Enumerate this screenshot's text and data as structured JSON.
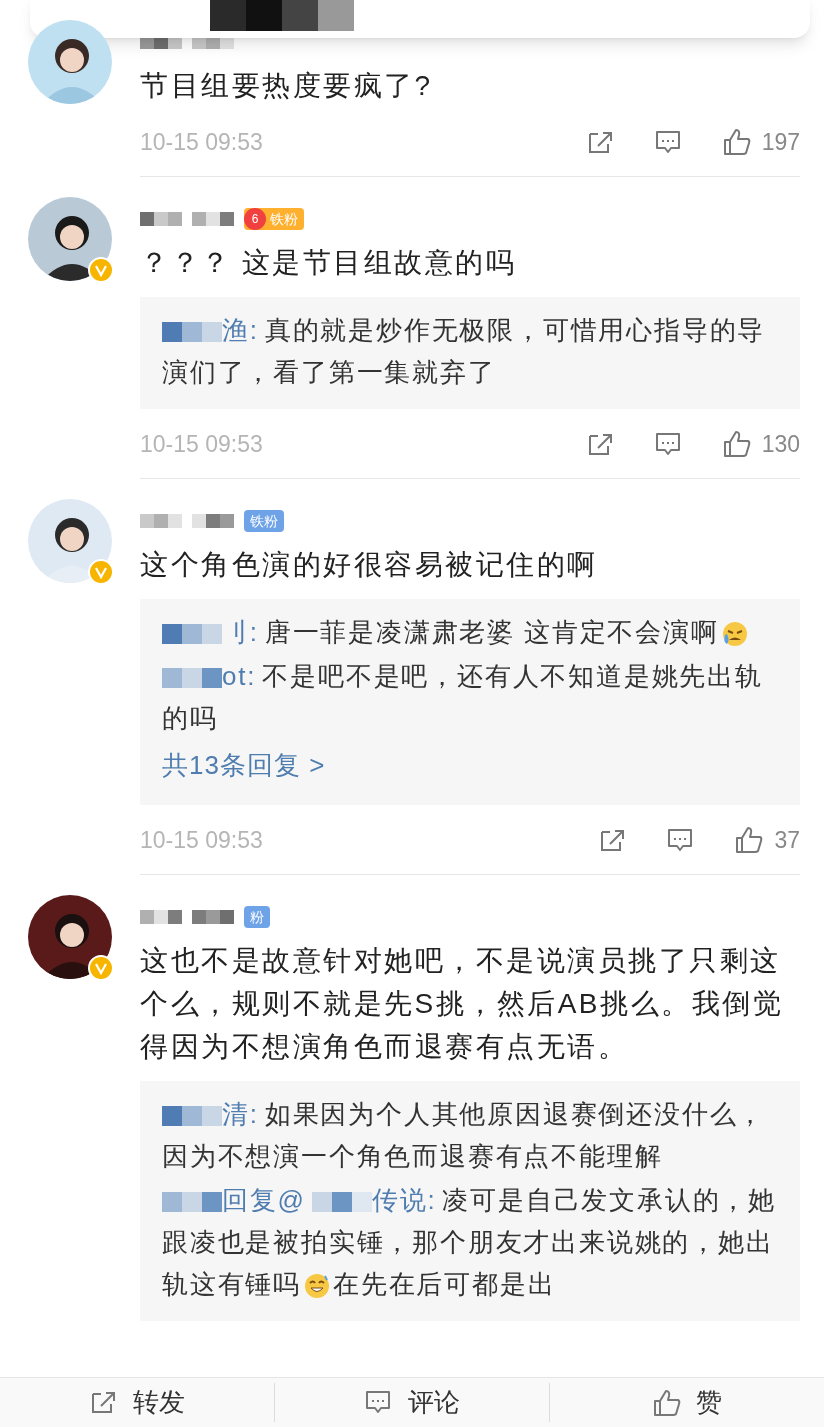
{
  "comments": [
    {
      "verified": false,
      "text": "节目组要热度要疯了?",
      "time": "10-15 09:53",
      "likes": "197"
    },
    {
      "verified": true,
      "badge": {
        "kind": "level",
        "level": "6",
        "label": "铁粉"
      },
      "text": "？？？ 这是节目组故意的吗",
      "replies": [
        {
          "author": [
            "渔:"
          ],
          "segments": [
            {
              "kind": "text",
              "text": "真的就是炒作无极限，可惜用心指导的导演们了，看了第一集就弃了"
            }
          ]
        }
      ],
      "time": "10-15 09:53",
      "likes": "130"
    },
    {
      "verified": true,
      "badge": {
        "kind": "plain",
        "label": "铁粉"
      },
      "text": "这个角色演的好很容易被记住的啊",
      "replies": [
        {
          "author": [
            "刂:"
          ],
          "segments": [
            {
              "kind": "text",
              "text": "唐一菲是凌潇肃老婆 这肯定不会演啊"
            },
            {
              "kind": "crying_emoji"
            }
          ]
        },
        {
          "author": [
            "ot:"
          ],
          "segments": [
            {
              "kind": "text",
              "text": "不是吧不是吧，还有人不知道是姚先出轨的吗"
            }
          ]
        }
      ],
      "more_replies": "共13条回复 >",
      "time": "10-15 09:53",
      "likes": "37"
    },
    {
      "verified": true,
      "badge": {
        "kind": "plain",
        "label": "粉"
      },
      "text": "这也不是故意针对她吧，不是说演员挑了只剩这个么，规则不就是先S挑，然后AB挑么。我倒觉得因为不想演角色而退赛有点无语。",
      "replies": [
        {
          "author": [
            "清:"
          ],
          "segments": [
            {
              "kind": "text",
              "text": "如果因为个人其他原因退赛倒还没什么，因为不想演一个角色而退赛有点不能理解"
            }
          ]
        },
        {
          "author": [
            "回复@",
            "传说:"
          ],
          "segments": [
            {
              "kind": "text",
              "text": "凌可是自己发文承认的，她跟凌也是被拍实锤，那个朋友才出来说姚的，她出轨这有锤吗"
            },
            {
              "kind": "grin_emoji"
            },
            {
              "kind": "text",
              "text": "在先在后可都是出"
            }
          ]
        }
      ]
    }
  ],
  "bottom_bar": [
    {
      "kind": "repost",
      "label": "转发"
    },
    {
      "kind": "comment",
      "label": "评论"
    },
    {
      "kind": "like",
      "label": "赞"
    }
  ]
}
